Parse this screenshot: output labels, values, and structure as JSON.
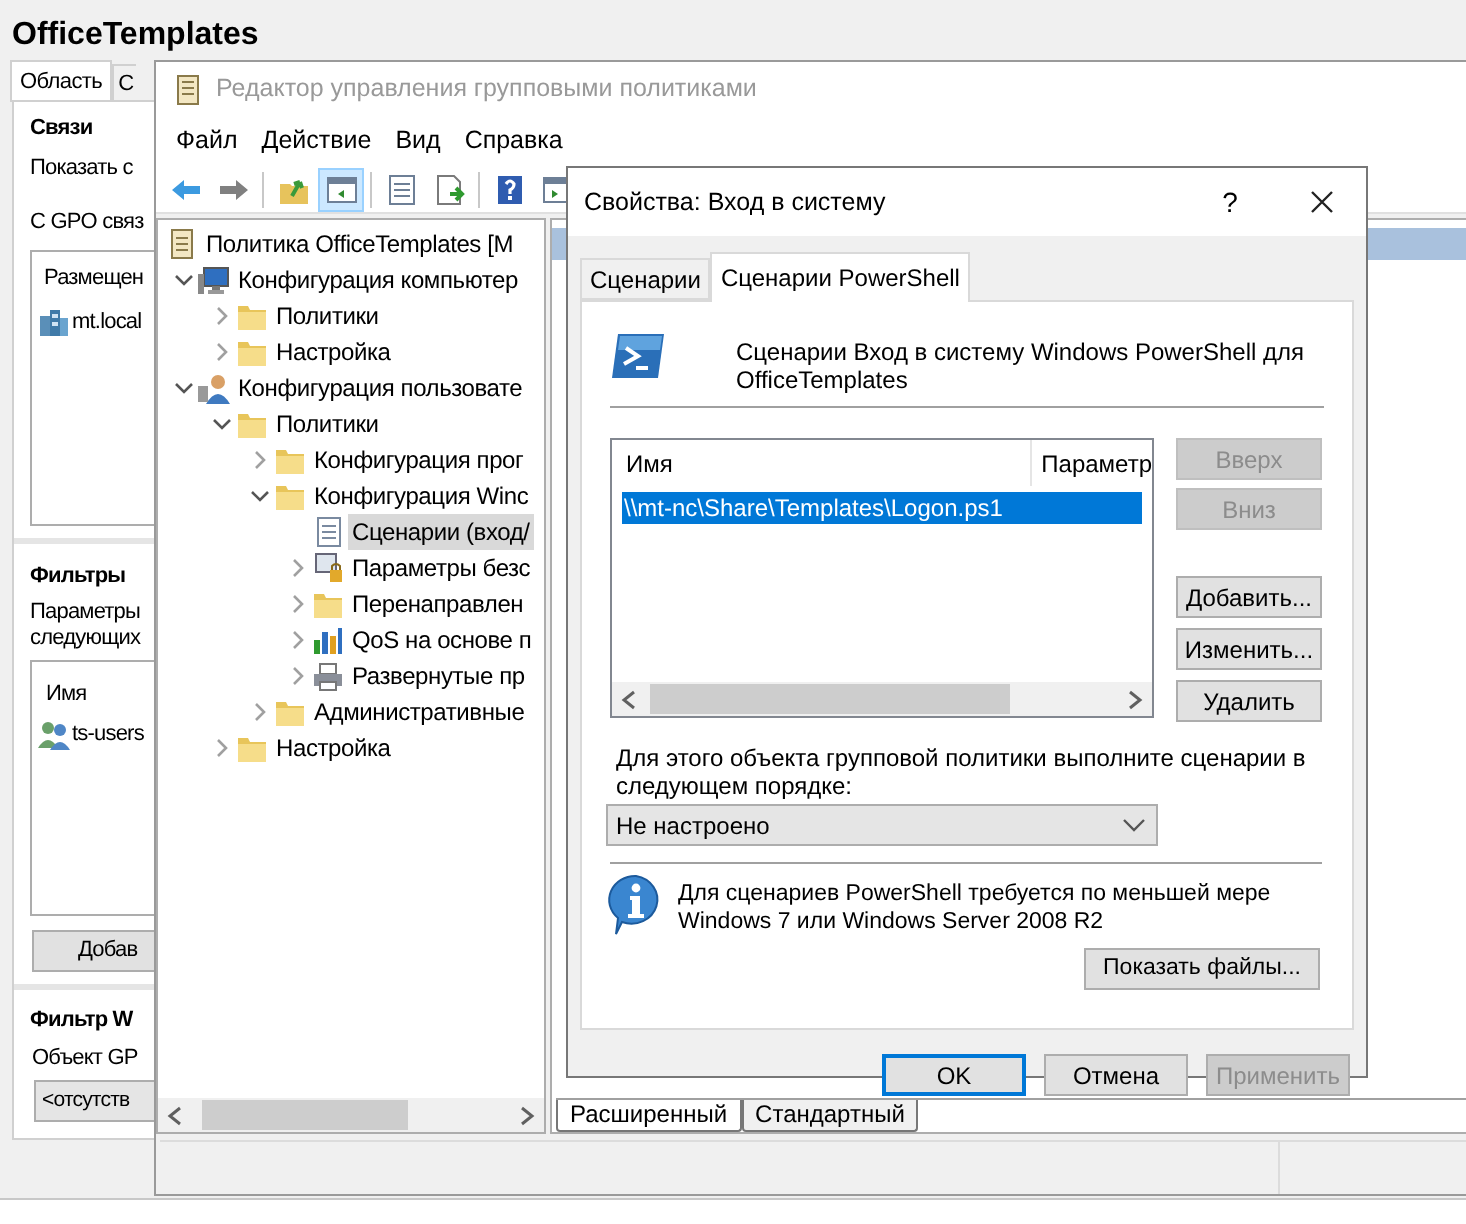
{
  "gpmc": {
    "title": "OfficeTemplates",
    "tabs": [
      {
        "label": "Область",
        "selected": true
      },
      {
        "label": "С",
        "selected": false
      }
    ],
    "links": {
      "heading": "Связи",
      "text": "Показать с",
      "label": "С GPO связ",
      "column": "Размещен",
      "items": [
        {
          "name": "mt.local"
        }
      ]
    },
    "security_filtering": {
      "heading": "Фильтры",
      "lines": [
        "Параметры",
        "следующих"
      ],
      "column": "Имя",
      "items": [
        {
          "name": "ts-users"
        }
      ],
      "button": "Добав"
    },
    "wmi_filtering": {
      "heading": "Фильтр W",
      "text": "Объект GP",
      "value": "<отсутств"
    }
  },
  "gpme": {
    "title": "Редактор управления групповыми политиками",
    "menu": [
      "Файл",
      "Действие",
      "Вид",
      "Справка"
    ],
    "toolbar": [
      {
        "kind": "back",
        "pressed": false
      },
      {
        "kind": "forward",
        "pressed": false
      },
      {
        "kind": "separator"
      },
      {
        "kind": "up",
        "pressed": false
      },
      {
        "kind": "tree",
        "pressed": true
      },
      {
        "kind": "separator"
      },
      {
        "kind": "properties",
        "pressed": false
      },
      {
        "kind": "export",
        "pressed": false
      },
      {
        "kind": "separator"
      },
      {
        "kind": "help",
        "pressed": false
      },
      {
        "kind": "pane"
      }
    ],
    "tree": [
      {
        "label": "Политика OfficeTemplates [M",
        "kind": "policy",
        "selected": false,
        "children": [
          {
            "label": "Конфигурация компьютер",
            "kind": "computer",
            "expanded": true,
            "selected": false,
            "children": [
              {
                "label": "Политики",
                "kind": "folder",
                "expanded": false,
                "selected": false
              },
              {
                "label": "Настройка",
                "kind": "folder",
                "expanded": false,
                "selected": false
              }
            ]
          },
          {
            "label": "Конфигурация пользовате",
            "kind": "user",
            "expanded": true,
            "selected": false,
            "children": [
              {
                "label": "Политики",
                "kind": "folder",
                "expanded": true,
                "selected": false,
                "children": [
                  {
                    "label": "Конфигурация прог",
                    "kind": "folder",
                    "expanded": false,
                    "selected": false
                  },
                  {
                    "label": "Конфигурация Winc",
                    "kind": "folder",
                    "expanded": true,
                    "selected": false,
                    "children": [
                      {
                        "label": "Сценарии (вход/",
                        "kind": "script",
                        "selected": true
                      },
                      {
                        "label": "Параметры безс",
                        "kind": "security",
                        "expanded": false,
                        "selected": false
                      },
                      {
                        "label": "Перенаправлен",
                        "kind": "folder",
                        "expanded": false,
                        "selected": false
                      },
                      {
                        "label": "QoS на основе п",
                        "kind": "chart",
                        "expanded": false,
                        "selected": false
                      },
                      {
                        "label": "Развернутые пр",
                        "kind": "printer",
                        "expanded": false,
                        "selected": false
                      }
                    ]
                  },
                  {
                    "label": "Административные",
                    "kind": "folder",
                    "expanded": false,
                    "selected": false
                  }
                ]
              },
              {
                "label": "Настройка",
                "kind": "folder",
                "expanded": false,
                "selected": false
              }
            ]
          }
        ]
      }
    ],
    "bottom_tabs": [
      {
        "label": "Расширенный",
        "selected": true
      },
      {
        "label": "Стандартный",
        "selected": false
      }
    ]
  },
  "dialog": {
    "title": "Свойства: Вход в систему",
    "help": "?",
    "tabs": [
      {
        "label": "Сценарии",
        "selected": false
      },
      {
        "label": "Сценарии PowerShell",
        "selected": true
      }
    ],
    "header": "Сценарии Вход в систему Windows PowerShell для OfficeTemplates",
    "columns": [
      "Имя",
      "Параметр"
    ],
    "rows": [
      {
        "name": "\\\\mt-nc\\Share\\Templates\\Logon.ps1",
        "selected": true
      }
    ],
    "side_buttons": [
      {
        "label": "Вверх",
        "disabled": true
      },
      {
        "label": "Вниз",
        "disabled": true
      },
      {
        "label": "Добавить...",
        "disabled": false
      },
      {
        "label": "Изменить...",
        "disabled": false
      },
      {
        "label": "Удалить",
        "disabled": false
      }
    ],
    "order_label": "Для этого объекта групповой политики выполните сценарии в следующем порядке:",
    "order_value": "Не настроено",
    "info": "Для сценариев PowerShell требуется по меньшей мере Windows 7 или Windows Server 2008 R2",
    "show_files": "Показать файлы...",
    "buttons": [
      {
        "label": "OK",
        "disabled": false,
        "default": true
      },
      {
        "label": "Отмена",
        "disabled": false,
        "default": false
      },
      {
        "label": "Применить",
        "disabled": true,
        "default": false
      }
    ]
  }
}
